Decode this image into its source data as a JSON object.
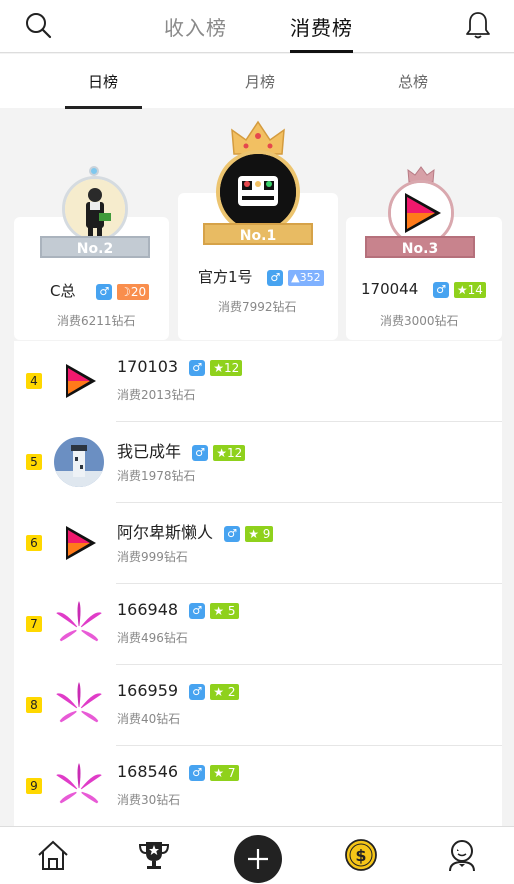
{
  "header": {
    "tab_income": "收入榜",
    "tab_consume": "消费榜",
    "active_tab": "消费榜"
  },
  "subtabs": {
    "daily": "日榜",
    "monthly": "月榜",
    "total": "总榜",
    "active": "日榜"
  },
  "podium": [
    {
      "rank_label": "No.2",
      "name": "C总",
      "level": "20",
      "level_icon": "moon-icon",
      "consumed": "消费6211钻石"
    },
    {
      "rank_label": "No.1",
      "name": "官方1号",
      "level": "352",
      "level_icon": "crown-icon",
      "consumed": "消费7992钻石"
    },
    {
      "rank_label": "No.3",
      "name": "170044",
      "level": "14",
      "level_icon": "star-icon",
      "consumed": "消费3000钻石"
    }
  ],
  "ranking": [
    {
      "rank": "4",
      "name": "170103",
      "level": "12",
      "consumed": "消费2013钻石",
      "avatar": "play-logo"
    },
    {
      "rank": "5",
      "name": "我已成年",
      "level": "12",
      "consumed": "消费1978钻石",
      "avatar": "lighthouse"
    },
    {
      "rank": "6",
      "name": "阿尔卑斯懒人",
      "level": "9",
      "consumed": "消费999钻石",
      "avatar": "play-logo"
    },
    {
      "rank": "7",
      "name": "166948",
      "level": "5",
      "consumed": "消费496钻石",
      "avatar": "flower"
    },
    {
      "rank": "8",
      "name": "166959",
      "level": "2",
      "consumed": "消费40钻石",
      "avatar": "flower"
    },
    {
      "rank": "9",
      "name": "168546",
      "level": "7",
      "consumed": "消费30钻石",
      "avatar": "flower"
    }
  ],
  "gender_symbol": "♂",
  "star_symbol": "★",
  "moon_symbol": "☽",
  "colors": {
    "male": "#47a3f0",
    "level_green": "#8fd11c",
    "rank_badge": "#ffd800",
    "gold": "#e8bb63"
  },
  "bottom_nav": [
    "home-icon",
    "trophy-icon",
    "plus-icon",
    "coin-icon",
    "profile-icon"
  ]
}
